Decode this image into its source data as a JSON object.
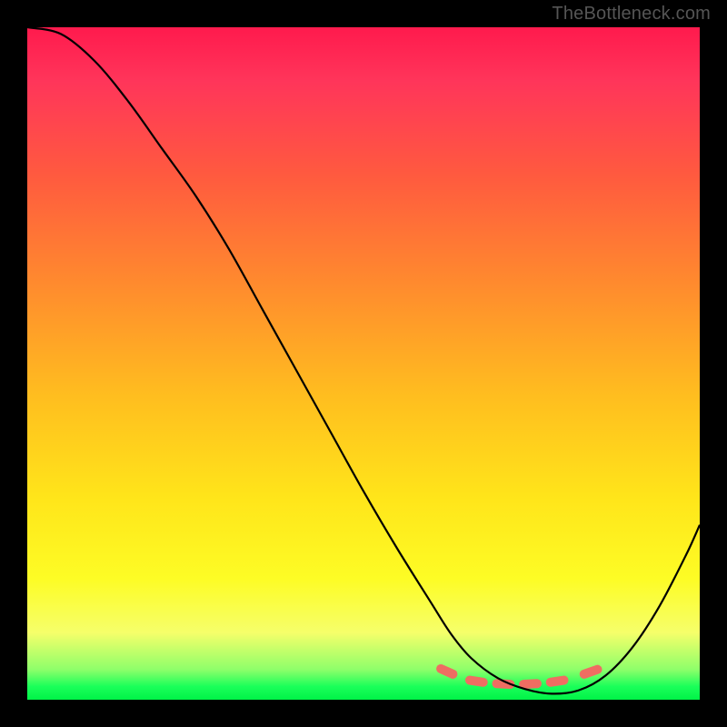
{
  "watermark": "TheBottleneck.com",
  "chart_data": {
    "type": "line",
    "title": "",
    "xlabel": "",
    "ylabel": "",
    "xlim": [
      0,
      100
    ],
    "ylim": [
      0,
      100
    ],
    "grid": false,
    "legend": false,
    "series": [
      {
        "name": "bottleneck-curve",
        "color": "#000000",
        "x": [
          0,
          5,
          10,
          15,
          20,
          25,
          30,
          35,
          40,
          45,
          50,
          55,
          60,
          63,
          66,
          70,
          74,
          78,
          82,
          86,
          90,
          94,
          98,
          100
        ],
        "values": [
          100,
          99,
          95,
          89,
          82,
          75,
          67,
          58,
          49,
          40,
          31,
          22.5,
          14.5,
          9.8,
          6.2,
          3.2,
          1.6,
          0.9,
          1.4,
          3.6,
          7.8,
          13.9,
          21.6,
          26.0
        ]
      }
    ],
    "annotations": [
      {
        "name": "valley-dash-1",
        "x0": 61.5,
        "y0": 4.6,
        "x1": 63.3,
        "y1": 3.8,
        "color": "#ef6d62"
      },
      {
        "name": "valley-dash-2",
        "x0": 65.8,
        "y0": 2.9,
        "x1": 67.8,
        "y1": 2.6,
        "color": "#ef6d62"
      },
      {
        "name": "valley-dash-3",
        "x0": 69.8,
        "y0": 2.4,
        "x1": 71.8,
        "y1": 2.3,
        "color": "#ef6d62"
      },
      {
        "name": "valley-dash-4",
        "x0": 73.8,
        "y0": 2.3,
        "x1": 75.8,
        "y1": 2.4,
        "color": "#ef6d62"
      },
      {
        "name": "valley-dash-5",
        "x0": 77.8,
        "y0": 2.6,
        "x1": 79.8,
        "y1": 2.9,
        "color": "#ef6d62"
      },
      {
        "name": "valley-dash-6",
        "x0": 82.8,
        "y0": 3.8,
        "x1": 84.8,
        "y1": 4.5,
        "color": "#ef6d62"
      }
    ]
  }
}
